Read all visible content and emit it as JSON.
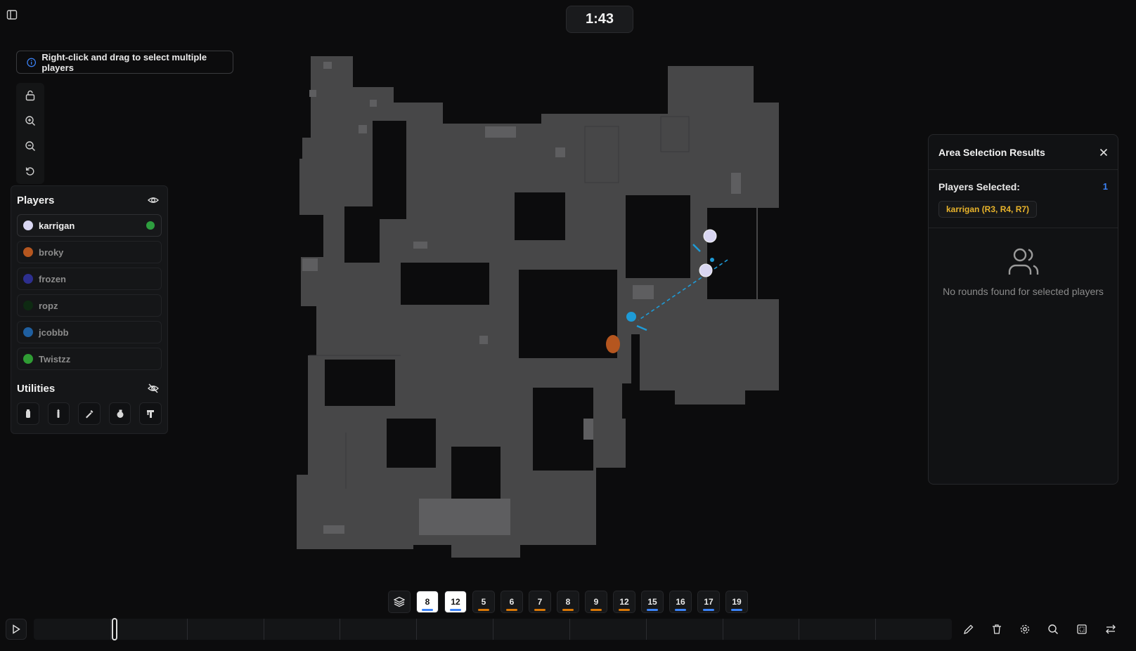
{
  "timer": "1:43",
  "hint": {
    "text": "Right-click and drag to select multiple players"
  },
  "players_panel": {
    "title": "Players",
    "items": [
      {
        "name": "karrigan",
        "color": "#d9d6f2",
        "active": true
      },
      {
        "name": "broky",
        "color": "#b5561f",
        "active": false
      },
      {
        "name": "frozen",
        "color": "#2d2f8f",
        "active": false
      },
      {
        "name": "ropz",
        "color": "#0e2a12",
        "active": false
      },
      {
        "name": "jcobbb",
        "color": "#1f5fa0",
        "active": false
      },
      {
        "name": "Twistzz",
        "color": "#2f9c34",
        "active": false
      }
    ],
    "active_status_color": "#2e9e3f"
  },
  "utilities": {
    "title": "Utilities",
    "items": [
      "smoke-icon",
      "flash-icon",
      "molotov-icon",
      "grenade-icon",
      "decoy-icon"
    ]
  },
  "results": {
    "title": "Area Selection Results",
    "players_selected_label": "Players Selected:",
    "players_selected_count": "1",
    "chip": "karrigan (R3, R4, R7)",
    "empty_message": "No rounds found for selected players"
  },
  "rounds": [
    {
      "label": "8",
      "selected": true,
      "team_color": "#3b82f6"
    },
    {
      "label": "12",
      "selected": true,
      "team_color": "#3b82f6"
    },
    {
      "label": "5",
      "selected": false,
      "team_color": "#d97706"
    },
    {
      "label": "6",
      "selected": false,
      "team_color": "#d97706"
    },
    {
      "label": "7",
      "selected": false,
      "team_color": "#d97706"
    },
    {
      "label": "8",
      "selected": false,
      "team_color": "#d97706"
    },
    {
      "label": "9",
      "selected": false,
      "team_color": "#d97706"
    },
    {
      "label": "12",
      "selected": false,
      "team_color": "#d97706"
    },
    {
      "label": "15",
      "selected": false,
      "team_color": "#3b82f6"
    },
    {
      "label": "16",
      "selected": false,
      "team_color": "#3b82f6"
    },
    {
      "label": "17",
      "selected": false,
      "team_color": "#3b82f6"
    },
    {
      "label": "19",
      "selected": false,
      "team_color": "#3b82f6"
    }
  ],
  "timeline": {
    "segments": 11,
    "progress": 0.085
  },
  "colors": {
    "accent": "#3b82f6",
    "chip_text": "#e8b32b",
    "ct_blue": "#1e9bd7",
    "t_orange": "#b5561f"
  }
}
